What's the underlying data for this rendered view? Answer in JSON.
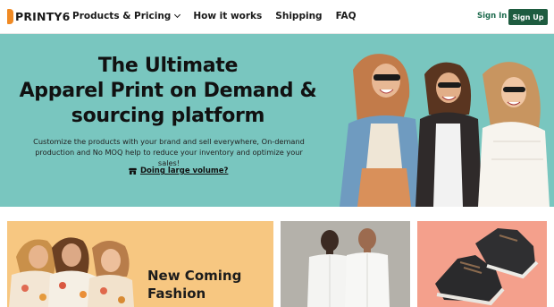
{
  "header": {
    "logo_text": "PRINTY6",
    "nav": [
      {
        "label": "Products & Pricing",
        "has_dropdown": true
      },
      {
        "label": "How it works"
      },
      {
        "label": "Shipping"
      },
      {
        "label": "FAQ"
      }
    ],
    "signin_label": "Sign In",
    "signup_label": "Sign Up"
  },
  "hero": {
    "title_line1": "The Ultimate",
    "title_line2": "Apparel Print on Demand &",
    "title_line3": "sourcing platform",
    "subtitle_line1": "Customize the products with your brand and sell everywhere, On-demand",
    "subtitle_line2": "production and No MOQ help to reduce your inventory and optimize your sales!",
    "link_label": "Doing large volume?",
    "link_icon": "store-icon"
  },
  "cards": [
    {
      "title_line1": "New Coming",
      "title_line2": "Fashion"
    },
    {
      "title_line1": "",
      "title_line2": ""
    },
    {
      "title_line1": "",
      "title_line2": ""
    }
  ],
  "colors": {
    "brand_orange": "#f08a24",
    "brand_green": "#1e5c40",
    "hero_bg": "#79c6bf",
    "card1_bg": "#f7c781",
    "card3_bg": "#f4a08c"
  }
}
